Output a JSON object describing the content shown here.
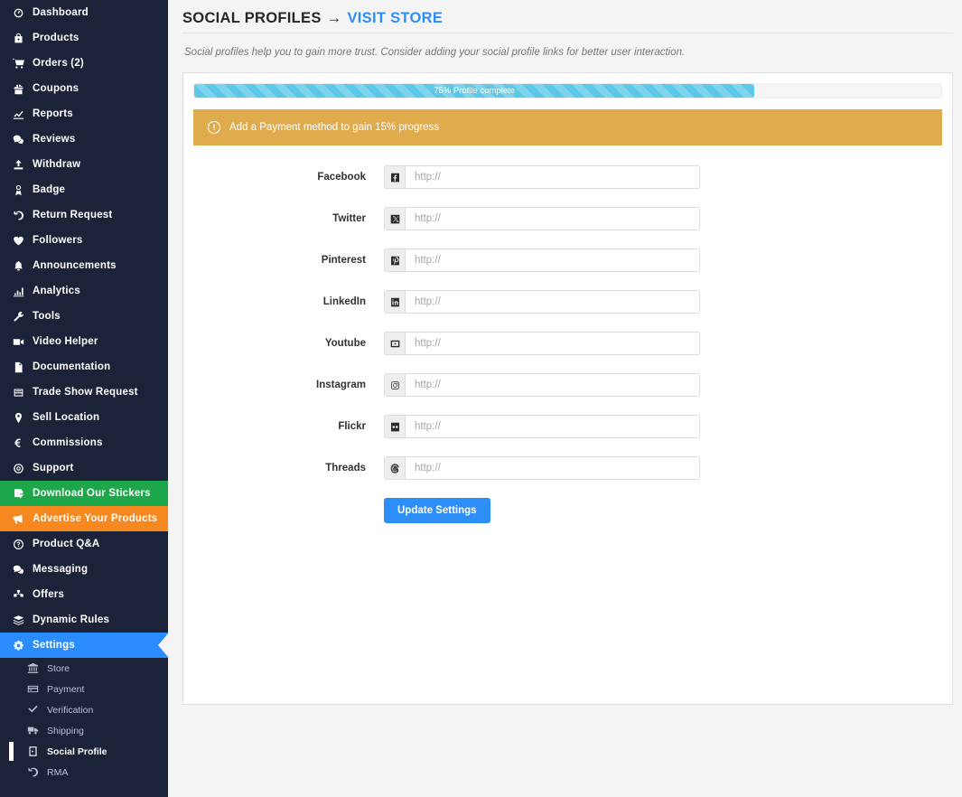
{
  "sidebar": {
    "items": [
      {
        "label": "Dashboard",
        "icon": "speedometer-icon",
        "style": "normal"
      },
      {
        "label": "Products",
        "icon": "bag-icon",
        "style": "normal"
      },
      {
        "label": "Orders (2)",
        "icon": "cart-icon",
        "style": "normal"
      },
      {
        "label": "Coupons",
        "icon": "gift-icon",
        "style": "normal"
      },
      {
        "label": "Reports",
        "icon": "chart-icon",
        "style": "normal"
      },
      {
        "label": "Reviews",
        "icon": "comments-icon",
        "style": "normal"
      },
      {
        "label": "Withdraw",
        "icon": "upload-icon",
        "style": "normal"
      },
      {
        "label": "Badge",
        "icon": "award-icon",
        "style": "normal"
      },
      {
        "label": "Return Request",
        "icon": "undo-icon",
        "style": "normal"
      },
      {
        "label": "Followers",
        "icon": "heart-icon",
        "style": "normal"
      },
      {
        "label": "Announcements",
        "icon": "bell-icon",
        "style": "normal"
      },
      {
        "label": "Analytics",
        "icon": "analytics-icon",
        "style": "normal"
      },
      {
        "label": "Tools",
        "icon": "wrench-icon",
        "style": "normal"
      },
      {
        "label": "Video Helper",
        "icon": "video-icon",
        "style": "normal"
      },
      {
        "label": "Documentation",
        "icon": "document-icon",
        "style": "normal"
      },
      {
        "label": "Trade Show Request",
        "icon": "inbox-icon",
        "style": "normal"
      },
      {
        "label": "Sell Location",
        "icon": "map-pin-icon",
        "style": "normal"
      },
      {
        "label": "Commissions",
        "icon": "euro-icon",
        "style": "normal"
      },
      {
        "label": "Support",
        "icon": "lifebuoy-icon",
        "style": "normal"
      },
      {
        "label": "Download Our Stickers",
        "icon": "sticker-icon",
        "style": "green"
      },
      {
        "label": "Advertise Your Products",
        "icon": "megaphone-icon",
        "style": "orange"
      },
      {
        "label": "Product Q&A",
        "icon": "question-icon",
        "style": "normal"
      },
      {
        "label": "Messaging",
        "icon": "chat-icon",
        "style": "normal"
      },
      {
        "label": "Offers",
        "icon": "offers-icon",
        "style": "normal"
      },
      {
        "label": "Dynamic Rules",
        "icon": "layers-icon",
        "style": "normal"
      },
      {
        "label": "Settings",
        "icon": "gear-icon",
        "style": "active"
      }
    ],
    "subitems": [
      {
        "label": "Store",
        "icon": "bank-icon",
        "active": false
      },
      {
        "label": "Payment",
        "icon": "credit-card-icon",
        "active": false
      },
      {
        "label": "Verification",
        "icon": "check-icon",
        "active": false
      },
      {
        "label": "Shipping",
        "icon": "truck-icon",
        "active": false
      },
      {
        "label": "Social Profile",
        "icon": "share-icon",
        "active": true
      },
      {
        "label": "RMA",
        "icon": "undo-icon",
        "active": false
      }
    ]
  },
  "header": {
    "title": "SOCIAL PROFILES",
    "arrow": "→",
    "store_link": "VISIT STORE",
    "subtitle": "Social profiles help you to gain more trust. Consider adding your social profile links for better user interaction."
  },
  "progress": {
    "percent": 75,
    "percent_width": "75%",
    "label": "75% Profile complete",
    "fill_color": "#5bc8e8"
  },
  "notice": {
    "icon": "info-icon",
    "icon_glyph": "!",
    "link_text": "Add a Payment method",
    "rest_text": " to gain 15% progress",
    "bg_color": "#dfab4d"
  },
  "form": {
    "placeholder": "http://",
    "fields": [
      {
        "label": "Facebook",
        "icon": "facebook-icon",
        "value": ""
      },
      {
        "label": "Twitter",
        "icon": "twitter-x-icon",
        "value": ""
      },
      {
        "label": "Pinterest",
        "icon": "pinterest-icon",
        "value": ""
      },
      {
        "label": "LinkedIn",
        "icon": "linkedin-icon",
        "value": ""
      },
      {
        "label": "Youtube",
        "icon": "youtube-icon",
        "value": ""
      },
      {
        "label": "Instagram",
        "icon": "instagram-icon",
        "value": ""
      },
      {
        "label": "Flickr",
        "icon": "flickr-icon",
        "value": ""
      },
      {
        "label": "Threads",
        "icon": "threads-icon",
        "value": ""
      }
    ],
    "submit_label": "Update Settings",
    "submit_color": "#2e8ef7"
  }
}
